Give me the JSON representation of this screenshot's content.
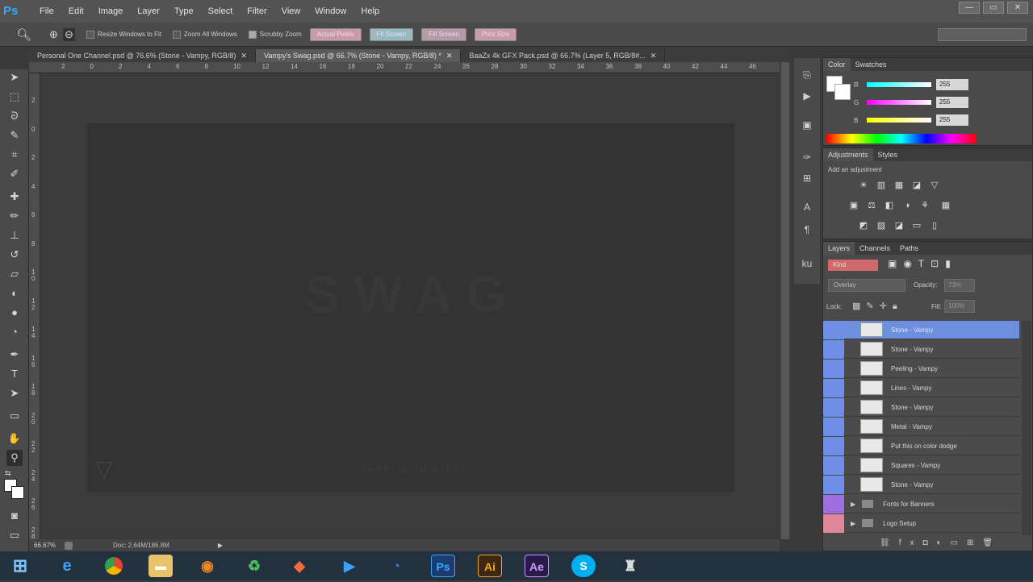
{
  "app": {
    "logo": "Ps",
    "menu": [
      "File",
      "Edit",
      "Image",
      "Layer",
      "Type",
      "Select",
      "Filter",
      "View",
      "Window",
      "Help"
    ],
    "window_controls": [
      "—",
      "▭",
      "✕"
    ]
  },
  "options_bar": {
    "resize_windows": "Resize Windows to Fit",
    "zoom_all": "Zoom All Windows",
    "scrubby_zoom": "Scrubby Zoom",
    "buttons": [
      "Actual Pixels",
      "Fit Screen",
      "Fill Screen",
      "Print Size"
    ]
  },
  "tabs": [
    {
      "label": "Personal One Channel.psd @ 76.6% (Stone - Vampy, RGB/8)"
    },
    {
      "label": "Vampy's Swag.psd @ 66.7% (Stone - Vampy, RGB/8) *"
    },
    {
      "label": "BaaZx 4k GFX Pack.psd @ 66.7% (Layer 5, RGB/8#..."
    }
  ],
  "ruler": {
    "h_ticks": [
      "2",
      "0",
      "2",
      "4",
      "6",
      "8",
      "10",
      "12",
      "14",
      "16",
      "18",
      "20",
      "22",
      "24",
      "26",
      "28",
      "30",
      "32",
      "34",
      "36",
      "38",
      "40",
      "42",
      "44",
      "46"
    ],
    "v_ticks": [
      "2",
      "0",
      "2",
      "4",
      "6",
      "8",
      "1 0",
      "1 2",
      "1 4",
      "1 6",
      "1 8",
      "2 0",
      "2 2",
      "2 4",
      "2 6",
      "2 8"
    ]
  },
  "canvas": {
    "headline": "SWAG",
    "footer": "VAMPY'S 3D STUFF"
  },
  "status": {
    "zoom": "66.67%",
    "doc": "Doc: 2.64M/186.8M"
  },
  "color_panel": {
    "tabs": [
      "Color",
      "Swatches"
    ],
    "channels": [
      {
        "label": "R",
        "value": "255"
      },
      {
        "label": "G",
        "value": "255"
      },
      {
        "label": "B",
        "value": "255"
      }
    ]
  },
  "adjustments_panel": {
    "tabs": [
      "Adjustments",
      "Styles"
    ],
    "hint": "Add an adjustment"
  },
  "layers_panel": {
    "tabs": [
      "Layers",
      "Channels",
      "Paths"
    ],
    "kind": "Kind",
    "blend_mode": "Overlay",
    "opacity_label": "Opacity:",
    "opacity_value": "73%",
    "lock_label": "Lock:",
    "fill_label": "Fill:",
    "fill_value": "100%",
    "layers": [
      {
        "name": "Stone - Vampy",
        "selected": true
      },
      {
        "name": "Stone - Vampy",
        "selected": false
      },
      {
        "name": "Peeling - Vampy",
        "selected": false
      },
      {
        "name": "Lines - Vampy",
        "selected": false
      },
      {
        "name": "Stone - Vampy",
        "selected": false
      },
      {
        "name": "Metal - Vampy",
        "selected": false
      },
      {
        "name": "Put this on color dodge",
        "selected": false
      },
      {
        "name": "Squares - Vampy",
        "selected": false
      },
      {
        "name": "Stone - Vampy",
        "selected": false
      }
    ],
    "groups": [
      {
        "name": "Fonts for Banners"
      },
      {
        "name": "Logo Setup"
      }
    ]
  },
  "colors": {
    "accent": "#34a8ff",
    "selection": "#6d8fe0",
    "taskbar": "#23303e"
  },
  "taskbar": {
    "items": [
      "start-icon",
      "ie-icon",
      "chrome-icon",
      "explorer-icon",
      "media-icon",
      "recycle-icon",
      "app-icon",
      "play-icon",
      "steam-icon",
      "Ps",
      "Ai",
      "Ae",
      "S",
      "app2-icon"
    ]
  }
}
